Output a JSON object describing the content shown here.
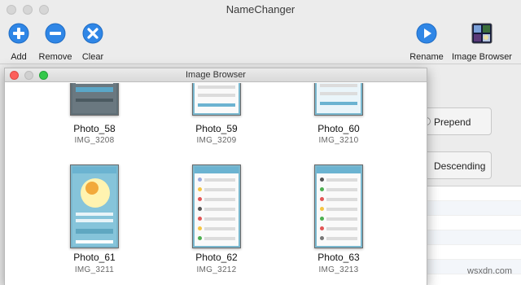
{
  "main_window": {
    "title": "NameChanger",
    "toolbar": {
      "add_label": "Add",
      "remove_label": "Remove",
      "clear_label": "Clear",
      "rename_label": "Rename",
      "image_browser_label": "Image Browser"
    },
    "options": {
      "prepend_label": "Prepend",
      "descending_label": "Descending"
    }
  },
  "image_browser": {
    "title": "Image Browser",
    "photos": [
      {
        "name": "Photo_58",
        "file": "IMG_3208"
      },
      {
        "name": "Photo_59",
        "file": "IMG_3209"
      },
      {
        "name": "Photo_60",
        "file": "IMG_3210"
      },
      {
        "name": "Photo_61",
        "file": "IMG_3211"
      },
      {
        "name": "Photo_62",
        "file": "IMG_3212"
      },
      {
        "name": "Photo_63",
        "file": "IMG_3213"
      }
    ]
  },
  "colors": {
    "toolbar_icon_blue": "#2f86e6",
    "traffic_close": "#fc605b",
    "traffic_minimize": "#fdbc40",
    "traffic_zoom": "#34c84a"
  },
  "watermark": "wsxdn.com"
}
